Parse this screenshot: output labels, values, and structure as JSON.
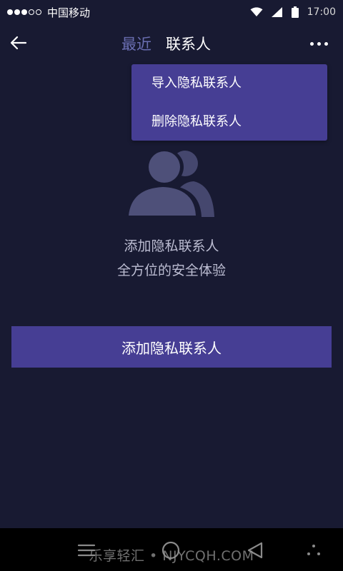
{
  "status_bar": {
    "carrier": "中国移动",
    "time": "17:00"
  },
  "header": {
    "tabs": [
      {
        "label": "最近",
        "active": false
      },
      {
        "label": "联系人",
        "active": true
      }
    ]
  },
  "dropdown": {
    "items": [
      {
        "label": "导入隐私联系人"
      },
      {
        "label": "删除隐私联系人"
      }
    ]
  },
  "empty_state": {
    "icon": "contacts-icon",
    "line1": "添加隐私联系人",
    "line2": "全方位的安全体验"
  },
  "add_button": {
    "label": "添加隐私联系人"
  },
  "watermark": "乐享轻汇 • NJYCQH.COM",
  "colors": {
    "background": "#181a32",
    "accent": "#463e94",
    "tab_inactive": "#6b6fb3",
    "icon_gray": "#4e5079"
  }
}
